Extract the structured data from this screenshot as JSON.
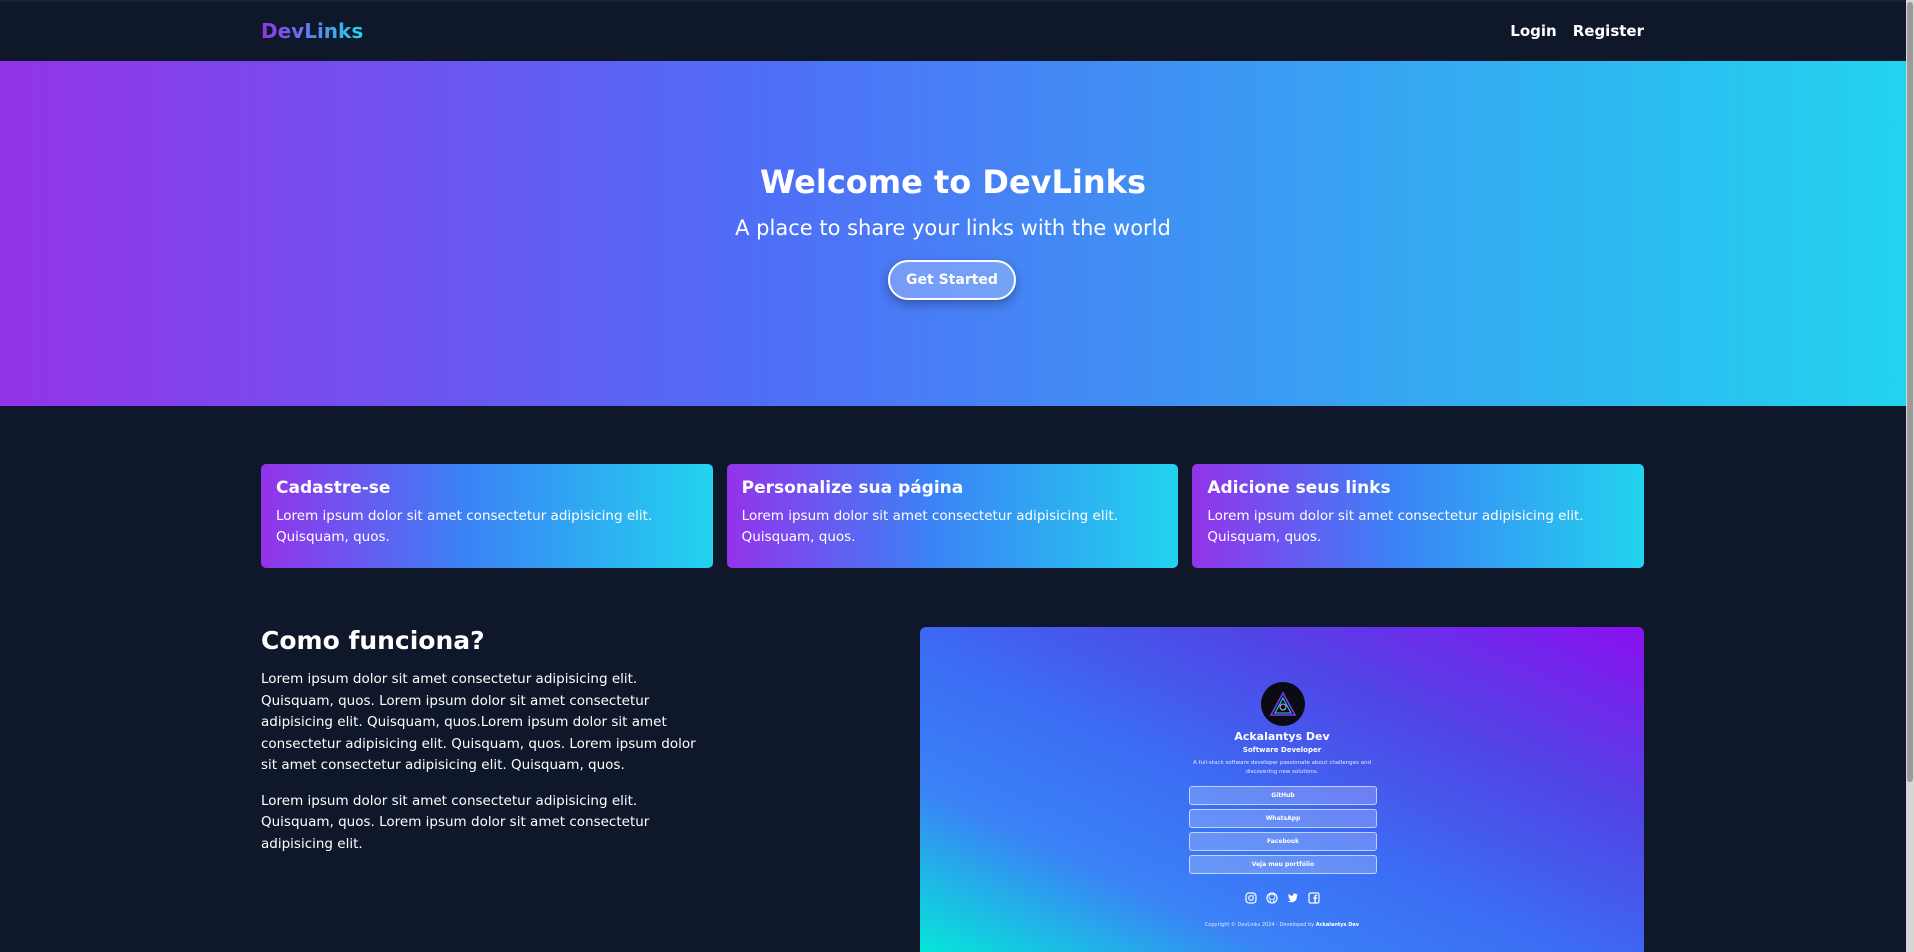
{
  "navbar": {
    "logo": "DevLinks",
    "links": [
      "Login",
      "Register"
    ]
  },
  "hero": {
    "title": "Welcome to DevLinks",
    "subtitle": "A place to share your links with the world",
    "cta_label": "Get Started"
  },
  "features": [
    {
      "title": "Cadastre-se",
      "text": "Lorem ipsum dolor sit amet consectetur adipisicing elit. Quisquam, quos."
    },
    {
      "title": "Personalize sua página",
      "text": "Lorem ipsum dolor sit amet consectetur adipisicing elit. Quisquam, quos."
    },
    {
      "title": "Adicione seus links",
      "text": "Lorem ipsum dolor sit amet consectetur adipisicing elit. Quisquam, quos."
    }
  ],
  "how": {
    "title": "Como funciona?",
    "paragraphs": [
      "Lorem ipsum dolor sit amet consectetur adipisicing elit. Quisquam, quos. Lorem ipsum dolor sit amet consectetur adipisicing elit. Quisquam, quos.Lorem ipsum dolor sit amet consectetur adipisicing elit. Quisquam, quos. Lorem ipsum dolor sit amet consectetur adipisicing elit. Quisquam, quos.",
      "Lorem ipsum dolor sit amet consectetur adipisicing elit. Quisquam, quos. Lorem ipsum dolor sit amet consectetur adipisicing elit."
    ]
  },
  "preview": {
    "name": "Ackalantys Dev",
    "role": "Software Developer",
    "description": "A full-stack software developer passionate about challenges and discovering new solutions.",
    "links": [
      "GitHub",
      "WhatsApp",
      "Facebook",
      "Veja meu portfólio"
    ],
    "socials": [
      "instagram-icon",
      "github-icon",
      "twitter-icon",
      "facebook-icon"
    ],
    "footer_prefix": "Copyright © DevLinks 2024 - Developed by",
    "footer_author": "Ackalantys Dev"
  },
  "colors": {
    "background": "#0f172a",
    "gradient_start": "#9333ea",
    "gradient_mid": "#3b82f6",
    "gradient_end": "#22d3ee"
  }
}
